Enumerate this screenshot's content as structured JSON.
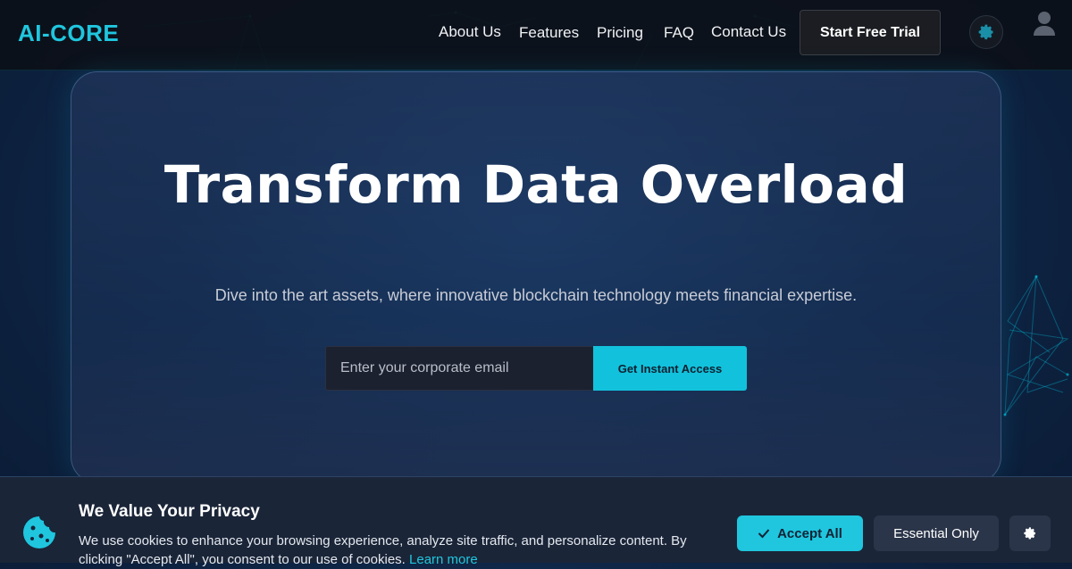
{
  "header": {
    "logo": "AI-CORE",
    "nav": [
      "About Us",
      "Features",
      "Pricing",
      "FAQ",
      "Contact Us"
    ],
    "cta_label": "Start Free Trial",
    "icons": [
      "gear-icon",
      "user-icon"
    ]
  },
  "hero": {
    "title": "Transform Data Overload",
    "subtitle": "Dive into the art assets, where innovative blockchain technology meets financial expertise.",
    "email_placeholder": "Enter your corporate email",
    "email_value": "",
    "submit_label": "Get Instant Access"
  },
  "cookie_banner": {
    "title": "We Value Your Privacy",
    "text": "We use cookies to enhance your browsing experience, analyze site traffic, and personalize content. By clicking \"Accept All\", you consent to our use of cookies.",
    "link_label": "Learn more",
    "accept_label": "Accept All",
    "essential_label": "Essential Only",
    "icons": [
      "cookie-icon",
      "check-icon",
      "gear-icon"
    ]
  },
  "colors": {
    "accent": "#1fc6de",
    "background": "#0f2748",
    "header": "#0c1018",
    "banner": "#1a2538"
  }
}
